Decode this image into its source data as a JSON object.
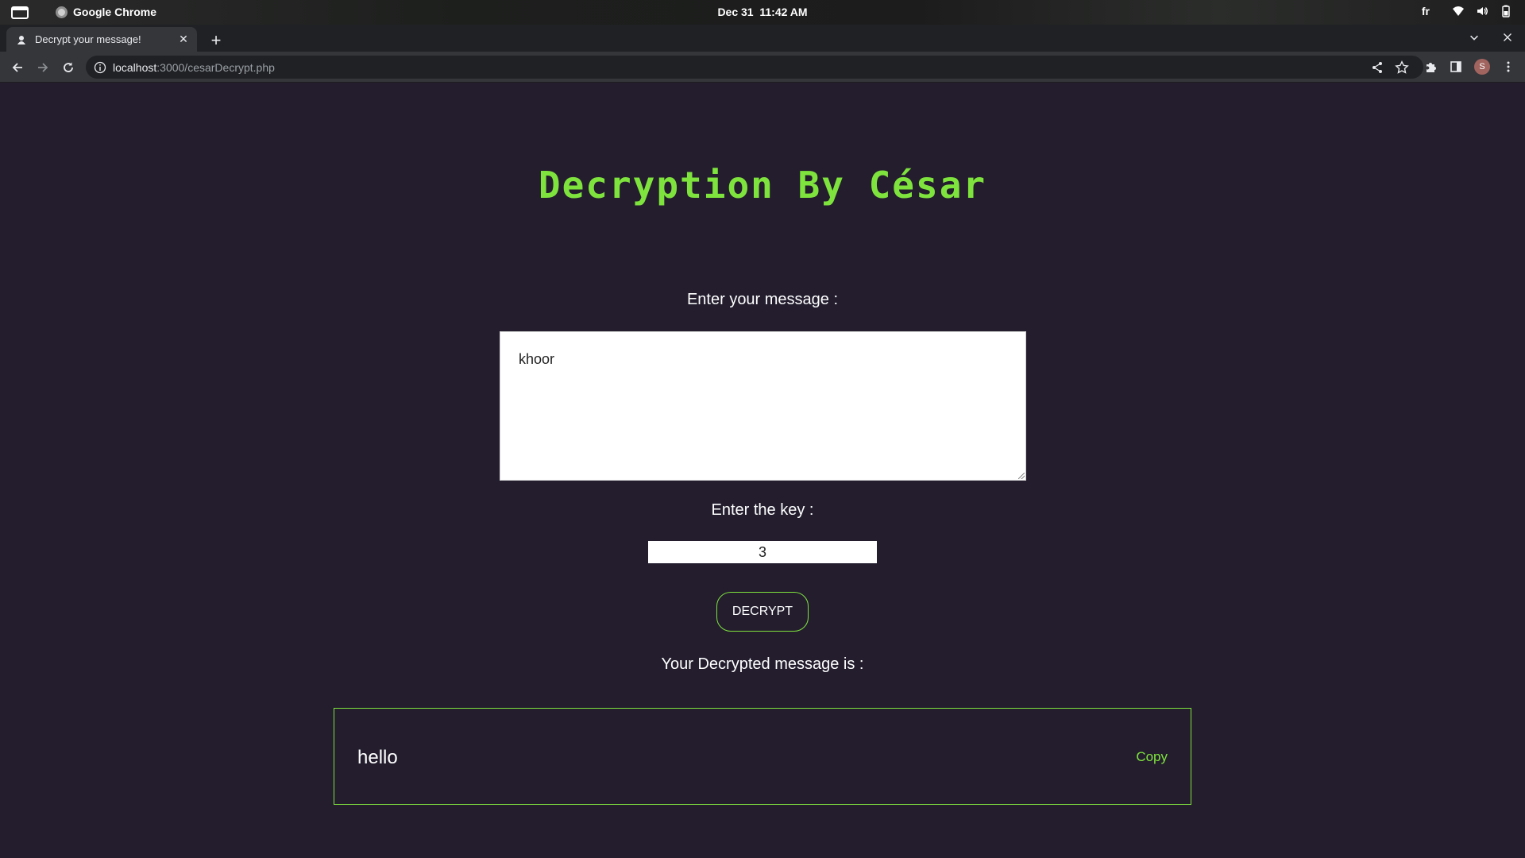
{
  "system_bar": {
    "app_name": "Google Chrome",
    "date": "Dec 31",
    "time": "11:42 AM",
    "keyboard_layout": "fr"
  },
  "browser": {
    "tab_title": "Decrypt your message!",
    "url_host": "localhost",
    "url_path": ":3000/cesarDecrypt.php",
    "avatar_initial": "S"
  },
  "page": {
    "heading": "Decryption By César",
    "message_label": "Enter your message :",
    "message_value": "khoor",
    "key_label": "Enter the key :",
    "key_value": "3",
    "decrypt_button": "DECRYPT",
    "result_label": "Your Decrypted message is :",
    "result_value": "hello",
    "copy_label": "Copy"
  },
  "colors": {
    "accent": "#7fe33d",
    "page_background": "#231d2e"
  }
}
